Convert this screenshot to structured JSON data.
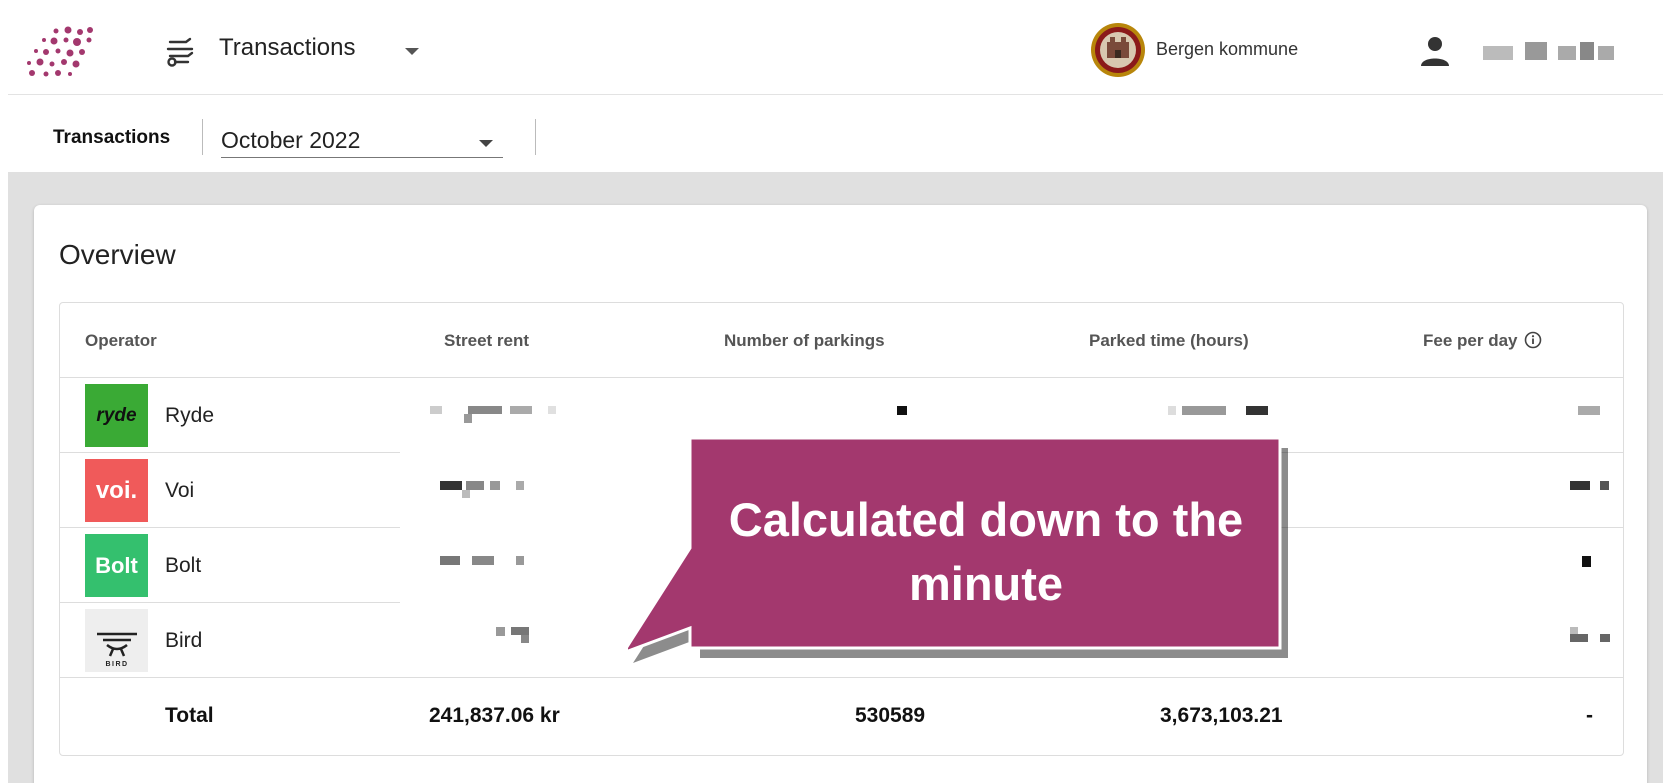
{
  "header": {
    "module_title": "Transactions",
    "organization": "Bergen kommune"
  },
  "subheader": {
    "label": "Transactions",
    "period_value": "October 2022"
  },
  "overview": {
    "title": "Overview",
    "columns": [
      "Operator",
      "Street rent",
      "Number of parkings",
      "Parked time (hours)",
      "Fee per day"
    ],
    "operators": [
      {
        "name": "Ryde",
        "logo_text": "ryde",
        "logo_color": "#3aaa35"
      },
      {
        "name": "Voi",
        "logo_text": "voi.",
        "logo_color": "#f05a5a"
      },
      {
        "name": "Bolt",
        "logo_text": "Bolt",
        "logo_color": "#34c06e"
      },
      {
        "name": "Bird",
        "logo_text": "BIRD",
        "logo_color": "#eeeeee"
      }
    ],
    "total": {
      "label": "Total",
      "street_rent": "241,837.06 kr",
      "parkings": "530589",
      "parked_time": "3,673,103.21",
      "fee_per_day": "-"
    }
  },
  "callout": {
    "text": "Calculated down to the minute",
    "color": "#a3386e"
  },
  "icons": {
    "logo": "dots-logo-icon",
    "module": "scooter-icon",
    "seal": "city-seal-icon",
    "user": "user-icon",
    "info": "info-icon"
  }
}
